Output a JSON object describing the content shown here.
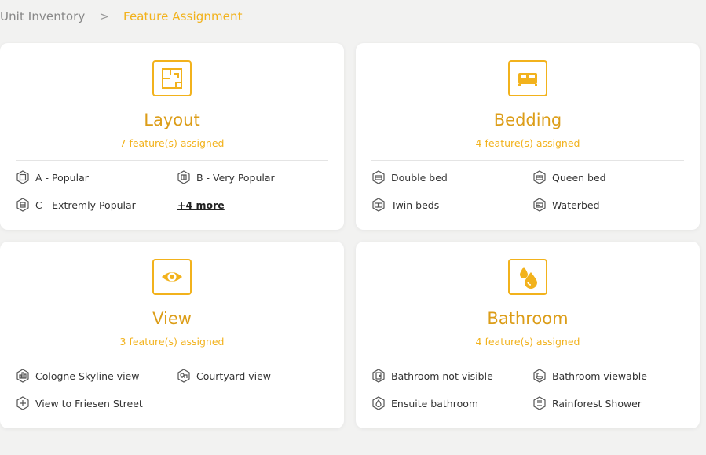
{
  "breadcrumb": {
    "parent": "Unit Inventory",
    "separator": ">",
    "current": "Feature Assignment"
  },
  "colors": {
    "accent": "#f2b21c",
    "title": "#dc9d18",
    "background": "#f2f2f1"
  },
  "cards": [
    {
      "title": "Layout",
      "subtitle": "7 feature(s) assigned",
      "icon": "floorplan-icon",
      "features": [
        {
          "label": "A - Popular",
          "icon": "layout-a-icon"
        },
        {
          "label": "B - Very Popular",
          "icon": "layout-b-icon"
        },
        {
          "label": "C - Extremly Popular",
          "icon": "layout-c-icon"
        }
      ],
      "more": "+4 more"
    },
    {
      "title": "Bedding",
      "subtitle": "4 feature(s) assigned",
      "icon": "bed-icon",
      "features": [
        {
          "label": "Double bed",
          "icon": "double-bed-icon"
        },
        {
          "label": "Queen bed",
          "icon": "queen-bed-icon"
        },
        {
          "label": "Twin beds",
          "icon": "twin-beds-icon"
        },
        {
          "label": "Waterbed",
          "icon": "waterbed-icon"
        }
      ]
    },
    {
      "title": "View",
      "subtitle": "3 feature(s) assigned",
      "icon": "eye-icon",
      "features": [
        {
          "label": "Cologne Skyline view",
          "icon": "skyline-icon"
        },
        {
          "label": "Courtyard view",
          "icon": "courtyard-icon"
        },
        {
          "label": "View to Friesen Street",
          "icon": "street-icon"
        }
      ]
    },
    {
      "title": "Bathroom",
      "subtitle": "4 feature(s) assigned",
      "icon": "water-drops-icon",
      "features": [
        {
          "label": "Bathroom not visible",
          "icon": "bathroom-closed-icon"
        },
        {
          "label": "Bathroom viewable",
          "icon": "bathroom-open-icon"
        },
        {
          "label": "Ensuite bathroom",
          "icon": "ensuite-icon"
        },
        {
          "label": "Rainforest Shower",
          "icon": "shower-icon"
        }
      ]
    }
  ]
}
